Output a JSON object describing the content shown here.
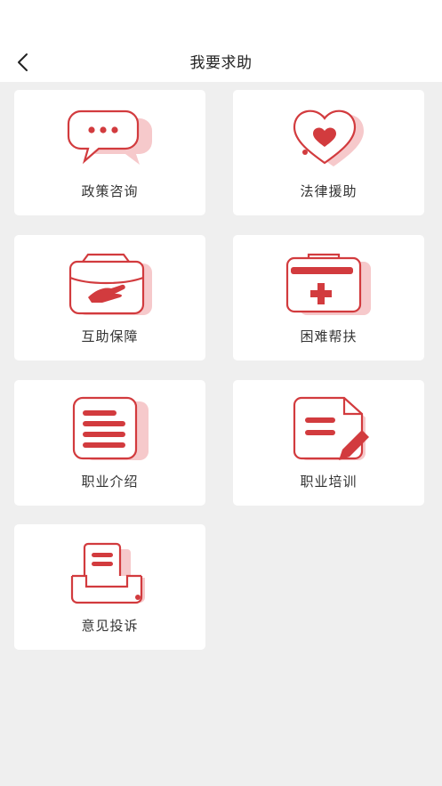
{
  "header": {
    "title": "我要求助"
  },
  "services": [
    {
      "label": "政策咨询",
      "icon": "chat-bubbles-icon"
    },
    {
      "label": "法律援助",
      "icon": "heart-icon"
    },
    {
      "label": "互助保障",
      "icon": "hand-box-icon"
    },
    {
      "label": "困难帮扶",
      "icon": "medical-kit-icon"
    },
    {
      "label": "职业介绍",
      "icon": "document-list-icon"
    },
    {
      "label": "职业培训",
      "icon": "document-pen-icon"
    },
    {
      "label": "意见投诉",
      "icon": "complaint-box-icon"
    }
  ],
  "colors": {
    "accent": "#d23b3e",
    "accent_light": "#f6c9cb",
    "background": "#efefef",
    "card": "#ffffff"
  }
}
